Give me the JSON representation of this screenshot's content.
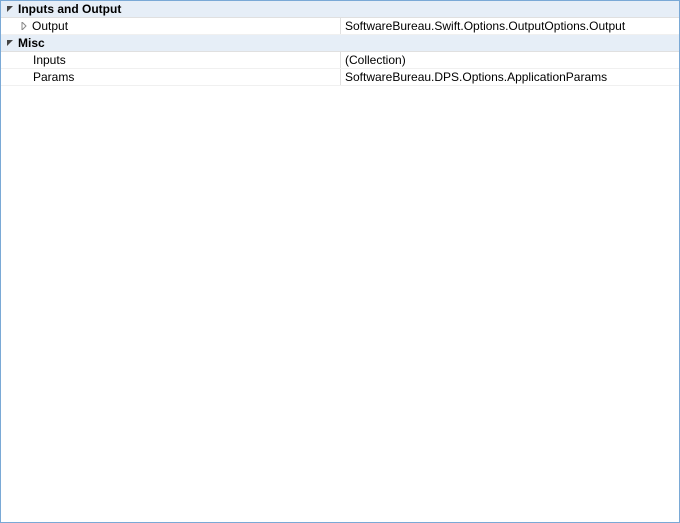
{
  "categories": [
    {
      "name": "Inputs and Output",
      "rows": [
        {
          "name": "Output",
          "value": "SoftwareBureau.Swift.Options.OutputOptions.Output",
          "expandable": true
        }
      ]
    },
    {
      "name": "Misc",
      "rows": [
        {
          "name": "Inputs",
          "value": "(Collection)",
          "expandable": false
        },
        {
          "name": "Params",
          "value": "SoftwareBureau.DPS.Options.ApplicationParams",
          "expandable": false
        }
      ]
    }
  ]
}
